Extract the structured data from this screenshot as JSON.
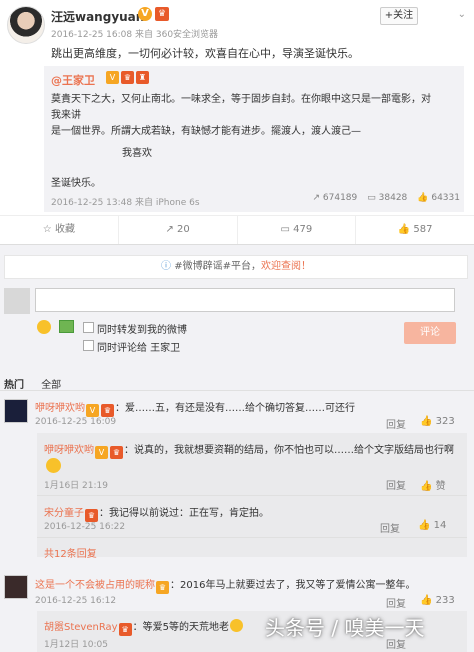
{
  "post": {
    "username": "汪远wangyuan",
    "verified_badge": "V",
    "follow_label": "+关注",
    "chevron": "⌄",
    "time": "2016-12-25 16:08",
    "source_prefix": "来自",
    "source": "360安全浏览器",
    "text": "跳出更高维度，一切何必计较，欢喜自在心中，导演圣诞快乐。"
  },
  "repost": {
    "author": "@王家卫",
    "lines": [
      "莫貴天下之大，又何止南北。一味求全，等于固步自封。在你眼中这只是一部電影，对我来讲",
      "是一個世界。所謂大成若缺，有缺憾才能有进步。擺渡人，渡人渡己—"
    ],
    "line3": "我喜欢",
    "line4": "圣诞快乐。",
    "time": "2016-12-25 13:48",
    "source_prefix": "来自",
    "source": "iPhone 6s",
    "forwards": "674189",
    "comments": "38428",
    "likes": "64331"
  },
  "actions": {
    "favorite": "☆ 收藏",
    "forward": "↗ 20",
    "comment": "▭ 479",
    "like": "👍 587"
  },
  "panel": {
    "notice_prefix": "#微博辟谣#平台，",
    "notice_link": "欢迎查阅！",
    "repost_to_weibo": "同时转发到我的微博",
    "comment_to": "同时评论给 王家卫",
    "submit": "评论",
    "tab_hot": "热门",
    "tab_all": "全部"
  },
  "comments": [
    {
      "name": "咿呀咿欢哟",
      "text": "：爱……五，有还是没有……给个确切答复……可还行",
      "time": "2016-12-25 16:09",
      "reply": "回复",
      "likes": "323"
    },
    {
      "name": "咿呀咿欢哟",
      "text": "：说真的，我就想要资鞘的结局，你不怕也可以……给个文字版结局也行啊",
      "time": "1月16日 21:19",
      "reply": "回复",
      "likes": "赞"
    },
    {
      "name": "宋分童子",
      "text": "：我记得以前说过：正在写，肯定拍。",
      "time": "2016-12-25 16:22",
      "reply": "回复",
      "likes": "14"
    },
    {
      "more": "共12条回复"
    },
    {
      "name": "这是一个不会被占用的昵称",
      "text": "：2016年马上就要过去了，我又等了爱情公寓一整年。",
      "time": "2016-12-25 16:12",
      "reply": "回复",
      "likes": "233"
    },
    {
      "name": "胡嚣StevenRay",
      "text": "：等爱5等的天荒地老",
      "time": "1月12日 10:05",
      "reply": "回复"
    }
  ],
  "watermark": "头条号 / 嗅美一天",
  "colors": {
    "accent": "#eb7350",
    "badge_gold": "#f6a623",
    "panel_bg": "#f2f2f5"
  }
}
